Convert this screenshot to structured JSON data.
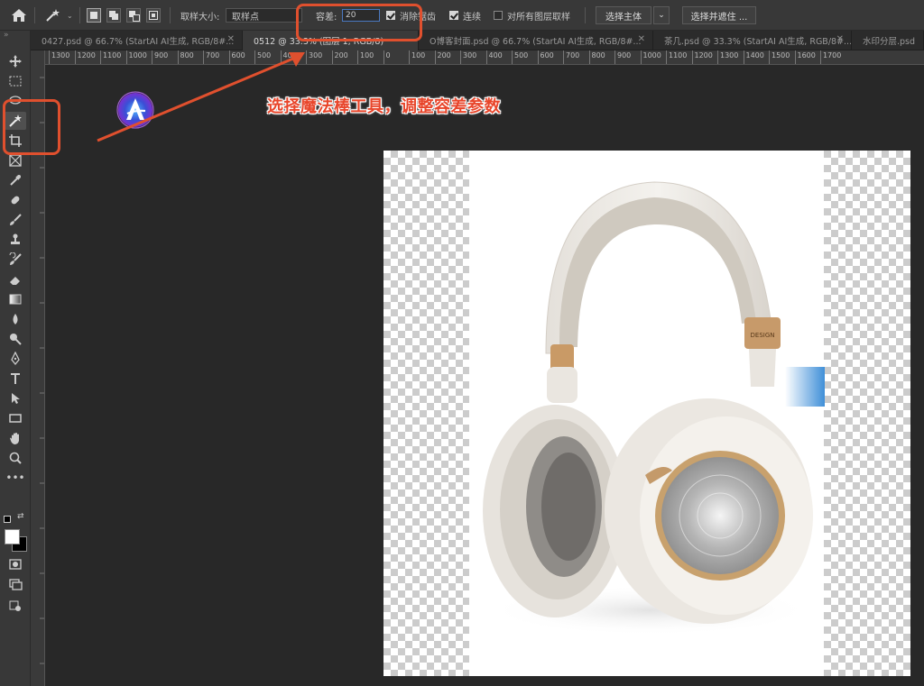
{
  "options_bar": {
    "sample_size_label": "取样大小:",
    "sample_size_value": "取样点",
    "tolerance_label": "容差:",
    "tolerance_value": "20",
    "antialias_label": "消除锯齿",
    "contiguous_label": "连续",
    "sample_all_layers_label": "对所有图层取样",
    "select_subject_label": "选择主体",
    "select_and_mask_label": "选择并遮住 ..."
  },
  "tabs": [
    {
      "label": "0427.psd @ 66.7% (StartAI AI生成, RGB/8#..."
    },
    {
      "label": "0512 @ 33.3% (图层 1, RGB/8)"
    },
    {
      "label": "O博客封面.psd @ 66.7% (StartAI AI生成, RGB/8#..."
    },
    {
      "label": "茶几.psd @ 33.3% (StartAI AI生成, RGB/8#..."
    },
    {
      "label": "水印分层.psd"
    }
  ],
  "ruler_ticks": [
    "1300",
    "1200",
    "1100",
    "1000",
    "900",
    "800",
    "700",
    "600",
    "500",
    "400",
    "300",
    "200",
    "100",
    "0",
    "100",
    "200",
    "300",
    "400",
    "500",
    "600",
    "700",
    "800",
    "900",
    "1000",
    "1100",
    "1200",
    "1300",
    "1400",
    "1500",
    "1600",
    "1700"
  ],
  "annotation": "选择魔法棒工具，调整容差参数",
  "canvas": {
    "product_text": "DESIGN"
  },
  "colors": {
    "accent": "#e0502e",
    "highlight_box": "#e0502e",
    "annotation_text": "#e8452a"
  }
}
